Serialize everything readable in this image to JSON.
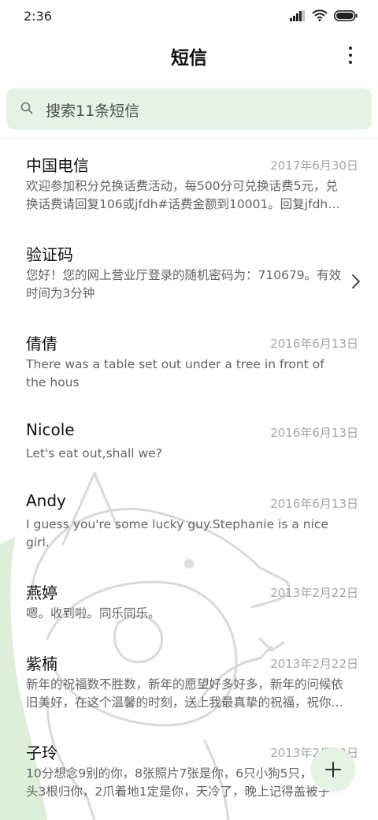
{
  "status_bar": {
    "time": "2:36"
  },
  "header": {
    "title": "短信"
  },
  "search": {
    "placeholder": "搜索11条短信"
  },
  "messages": [
    {
      "sender": "中国电信",
      "date": "2017年6月30日",
      "preview": "欢迎参加积分兑换话费活动，每500分可兑换话费5元，兑换话费请回复106或jfdh#话费金额到10001。回复jfdh#话费金额"
    },
    {
      "sender": "验证码",
      "date": "",
      "preview": "您好！您的网上营业厅登录的随机密码为：710679。有效时间为3分钟"
    },
    {
      "sender": "倩倩",
      "date": "2016年6月13日",
      "preview": "There was a table set out under a tree in front of the hous"
    },
    {
      "sender": "Nicole",
      "date": "2016年6月13日",
      "preview": "Let's eat out,shall we?"
    },
    {
      "sender": "Andy",
      "date": "2016年6月13日",
      "preview": "I guess you're some lucky guy.Stephanie is a nice girl."
    },
    {
      "sender": "燕婷",
      "date": "2013年2月22日",
      "preview": "嗯。收到啦。同乐同乐。"
    },
    {
      "sender": "紫楠",
      "date": "2013年2月22日",
      "preview": "新年的祝福数不胜数，新年的愿望好多好多，新年的问候依旧美好，在这个温馨的时刻，送上我最真挚的祝福，祝你新年快乐"
    },
    {
      "sender": "子玲",
      "date": "2013年2月22日",
      "preview": "10分想念9别的你，8张照片7张是你，6只小狗5只，4根骨头3根归你，2爪着地1定是你，天冷了，晚上记得盖被子"
    }
  ],
  "icons": {
    "search": "search-icon",
    "more": "more-vertical-icon",
    "chevron": "chevron-right-icon",
    "compose": "plus-icon"
  },
  "colors": {
    "accent": "#e5f3e6",
    "date": "#a6a6a6",
    "preview": "#636363"
  }
}
